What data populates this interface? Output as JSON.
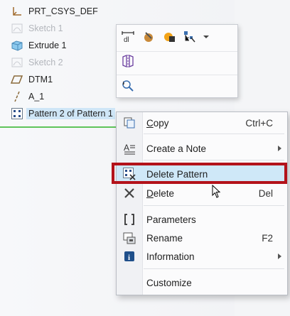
{
  "tree": {
    "items": [
      {
        "label": "PRT_CSYS_DEF",
        "icon": "csys-icon",
        "dim": false
      },
      {
        "label": "Sketch 1",
        "icon": "sketch-icon",
        "dim": true
      },
      {
        "label": "Extrude 1",
        "icon": "extrude-icon",
        "dim": false
      },
      {
        "label": "Sketch 2",
        "icon": "sketch-icon",
        "dim": true
      },
      {
        "label": "DTM1",
        "icon": "datum-plane-icon",
        "dim": false
      },
      {
        "label": "A_1",
        "icon": "axis-icon",
        "dim": false
      },
      {
        "label": "Pattern 2 of Pattern 1",
        "icon": "pattern-icon",
        "dim": false,
        "selected": true
      }
    ]
  },
  "mini_toolbar": {
    "icons": [
      "dimension-icon",
      "appearance-icon",
      "display-style-icon",
      "component-tree-icon",
      "dropdown-arrow-icon",
      "mirror-icon",
      "zoom-select-icon"
    ]
  },
  "menu": {
    "items": [
      {
        "label": "Copy",
        "shortcut": "Ctrl+C",
        "icon": "copy-icon"
      },
      {
        "label": "Create a Note",
        "icon": "note-icon",
        "submenu": true
      },
      {
        "label": "Delete Pattern",
        "icon": "delete-pattern-icon",
        "highlighted": true
      },
      {
        "label": "Delete",
        "shortcut": "Del",
        "icon": "delete-icon"
      },
      {
        "label": "Parameters",
        "icon": "parameters-icon"
      },
      {
        "label": "Rename",
        "shortcut": "F2",
        "icon": "rename-icon"
      },
      {
        "label": "Information",
        "icon": "information-icon",
        "submenu": true
      },
      {
        "label": "Customize"
      }
    ]
  },
  "colors": {
    "highlight_frame": "#b3121a",
    "menu_highlight": "#cfe8f8",
    "selection": "#cfe6f7"
  }
}
